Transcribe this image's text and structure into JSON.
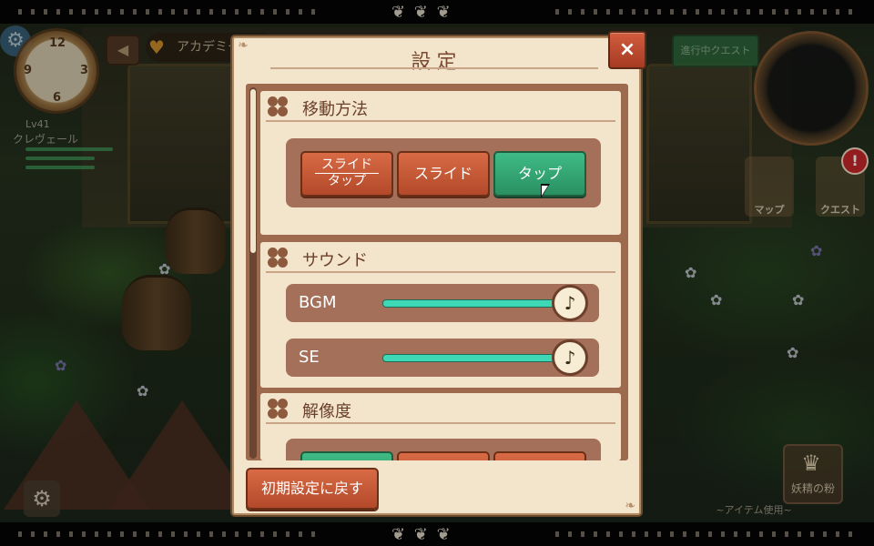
{
  "hud": {
    "level": "Lv41",
    "player_name": "クレヴェール",
    "location": "アカデミー",
    "quest_progress": "進行中クエスト",
    "map_label": "マップ",
    "quest_label": "クエスト",
    "alert": "!",
    "fairy_label": "妖精の粉",
    "item_use": "~アイテム使用~",
    "clock_numbers": [
      "12",
      "9",
      "3",
      "6"
    ]
  },
  "dialog": {
    "title": "設定",
    "close_label": "×",
    "sections": {
      "movement": {
        "title": "移動方法",
        "options": [
          {
            "line1": "スライド",
            "line2": "タップ",
            "selected": false
          },
          {
            "label": "スライド",
            "selected": false
          },
          {
            "label": "タップ",
            "selected": true
          }
        ]
      },
      "sound": {
        "title": "サウンド",
        "bgm_label": "BGM",
        "bgm_level": 1.0,
        "se_label": "SE",
        "se_level": 1.0,
        "knob_glyph": "♪"
      },
      "resolution": {
        "title": "解像度"
      }
    },
    "reset_label": "初期設定に戻す"
  },
  "colors": {
    "accent_orange": "#c85a36",
    "accent_green": "#35a574",
    "panel": "#f3e4cc",
    "brown": "#a4705a",
    "slider": "#3fd8b6"
  }
}
